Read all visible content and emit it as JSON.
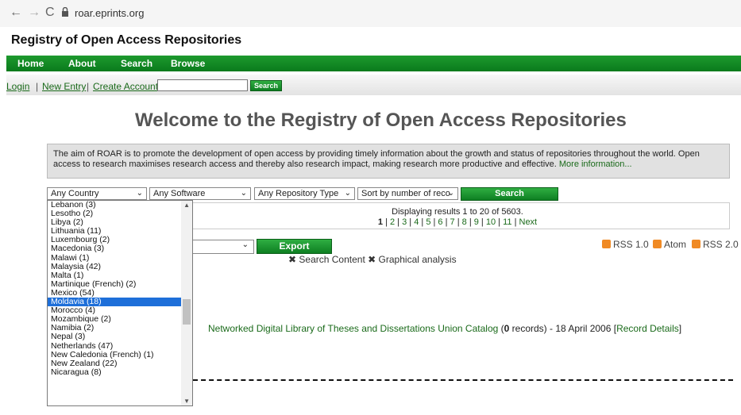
{
  "browser": {
    "url": "roar.eprints.org",
    "back": "←",
    "forward": "→",
    "reload": "C"
  },
  "site": {
    "title": "Registry of Open Access Repositories"
  },
  "menu": [
    "Home",
    "About",
    "Search",
    "Browse"
  ],
  "subnav": {
    "login": "Login",
    "new_entry": "New Entry",
    "create_account": "Create Account",
    "search_label": "Search"
  },
  "welcome": "Welcome to the Registry of Open Access Repositories",
  "aim": {
    "text": "The aim of ROAR is to promote the development of open access by providing timely information about the growth and status of repositories throughout the world. Open access to research maximises research access and thereby also research impact, making research more productive and effective. ",
    "link": "More information..."
  },
  "filters": {
    "country": "Any Country",
    "software": "Any Software",
    "repo_type": "Any Repository Type",
    "sort": "Sort by number of reco",
    "search": "Search"
  },
  "results": {
    "summary": "Displaying results 1 to 20 of 5603.",
    "current": "1",
    "pages": [
      "2",
      "3",
      "4",
      "5",
      "6",
      "7",
      "8",
      "9",
      "10",
      "11"
    ],
    "next": "Next",
    "sep": " | "
  },
  "export": {
    "button": "Export"
  },
  "rss": {
    "rss1": "RSS 1.0",
    "atom": "Atom",
    "rss2": "RSS 2.0"
  },
  "tools": {
    "search_content": "Search Content",
    "graphical": "Graphical analysis"
  },
  "record": {
    "link": "Networked Digital Library of Theses and Dissertations Union Catalog",
    "count_prefix": " (",
    "count": "0",
    "count_suffix": " records) - 18 April 2006 [",
    "details": "Record Details",
    "end": "]"
  },
  "countries": [
    "Lebanon (3)",
    "Lesotho (2)",
    "Libya (2)",
    "Lithuania (11)",
    "Luxembourg (2)",
    "Macedonia (3)",
    "Malawi (1)",
    "Malaysia (42)",
    "Malta (1)",
    "Martinique (French) (2)",
    "Mexico (54)",
    "Moldavia (18)",
    "Morocco (4)",
    "Mozambique (2)",
    "Namibia (2)",
    "Nepal (3)",
    "Netherlands (47)",
    "New Caledonia (French) (1)",
    "New Zealand (22)",
    "Nicaragua (8)"
  ],
  "selected_country": "Moldavia (18)"
}
